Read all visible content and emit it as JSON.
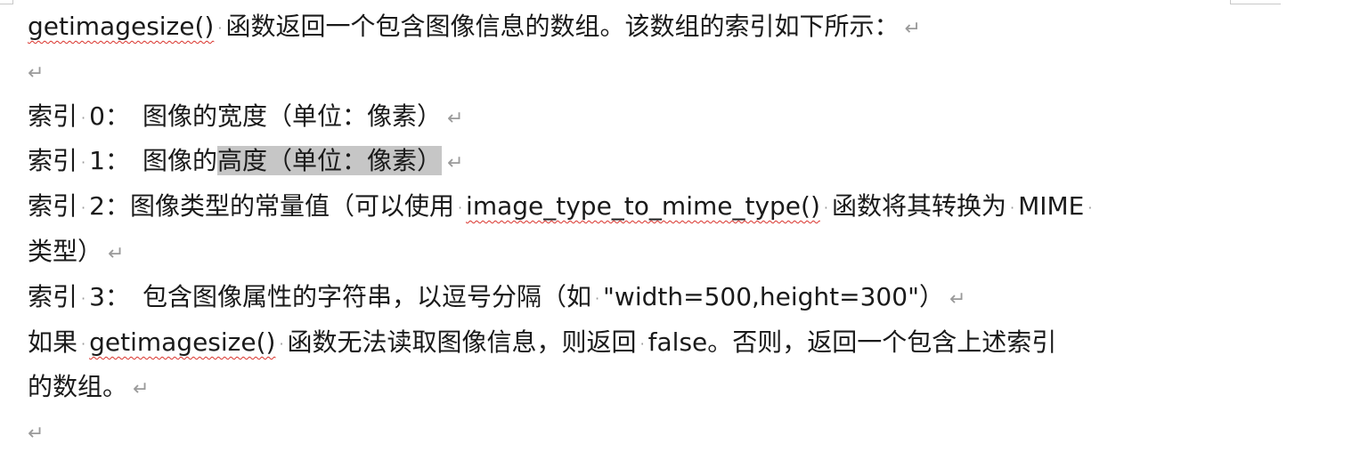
{
  "document": {
    "paragraph_mark": "↵",
    "space_mark": "·",
    "lines": [
      {
        "func": "getimagesize()",
        "text": "函数返回一个包含图像信息的数组。该数组的索引如下所示："
      },
      {
        "text": ""
      },
      {
        "label": "索引",
        "index": "0：",
        "text": "图像的宽度（单位：像素）"
      },
      {
        "label": "索引",
        "index": "1：",
        "text_before": "图像的",
        "text_selected": "高度（单位：像素）"
      },
      {
        "label": "索引",
        "index": "2：",
        "text_before": "图像类型的常量值（可以使用",
        "func": "image_type_to_mime_type()",
        "text_middle": "函数将其转换为",
        "term": "MIME"
      },
      {
        "text": "类型）"
      },
      {
        "label": "索引",
        "index": "3：",
        "text_before": "包含图像属性的字符串，以逗号分隔（如",
        "example": "\"width=500,height=300\"）"
      },
      {
        "text_before": "如果",
        "func": "getimagesize()",
        "text_middle": "函数无法读取图像信息，则返回",
        "keyword": "false",
        "text_after": "。否则，返回一个包含上述索引"
      },
      {
        "text": "的数组。"
      },
      {
        "text": ""
      }
    ]
  }
}
